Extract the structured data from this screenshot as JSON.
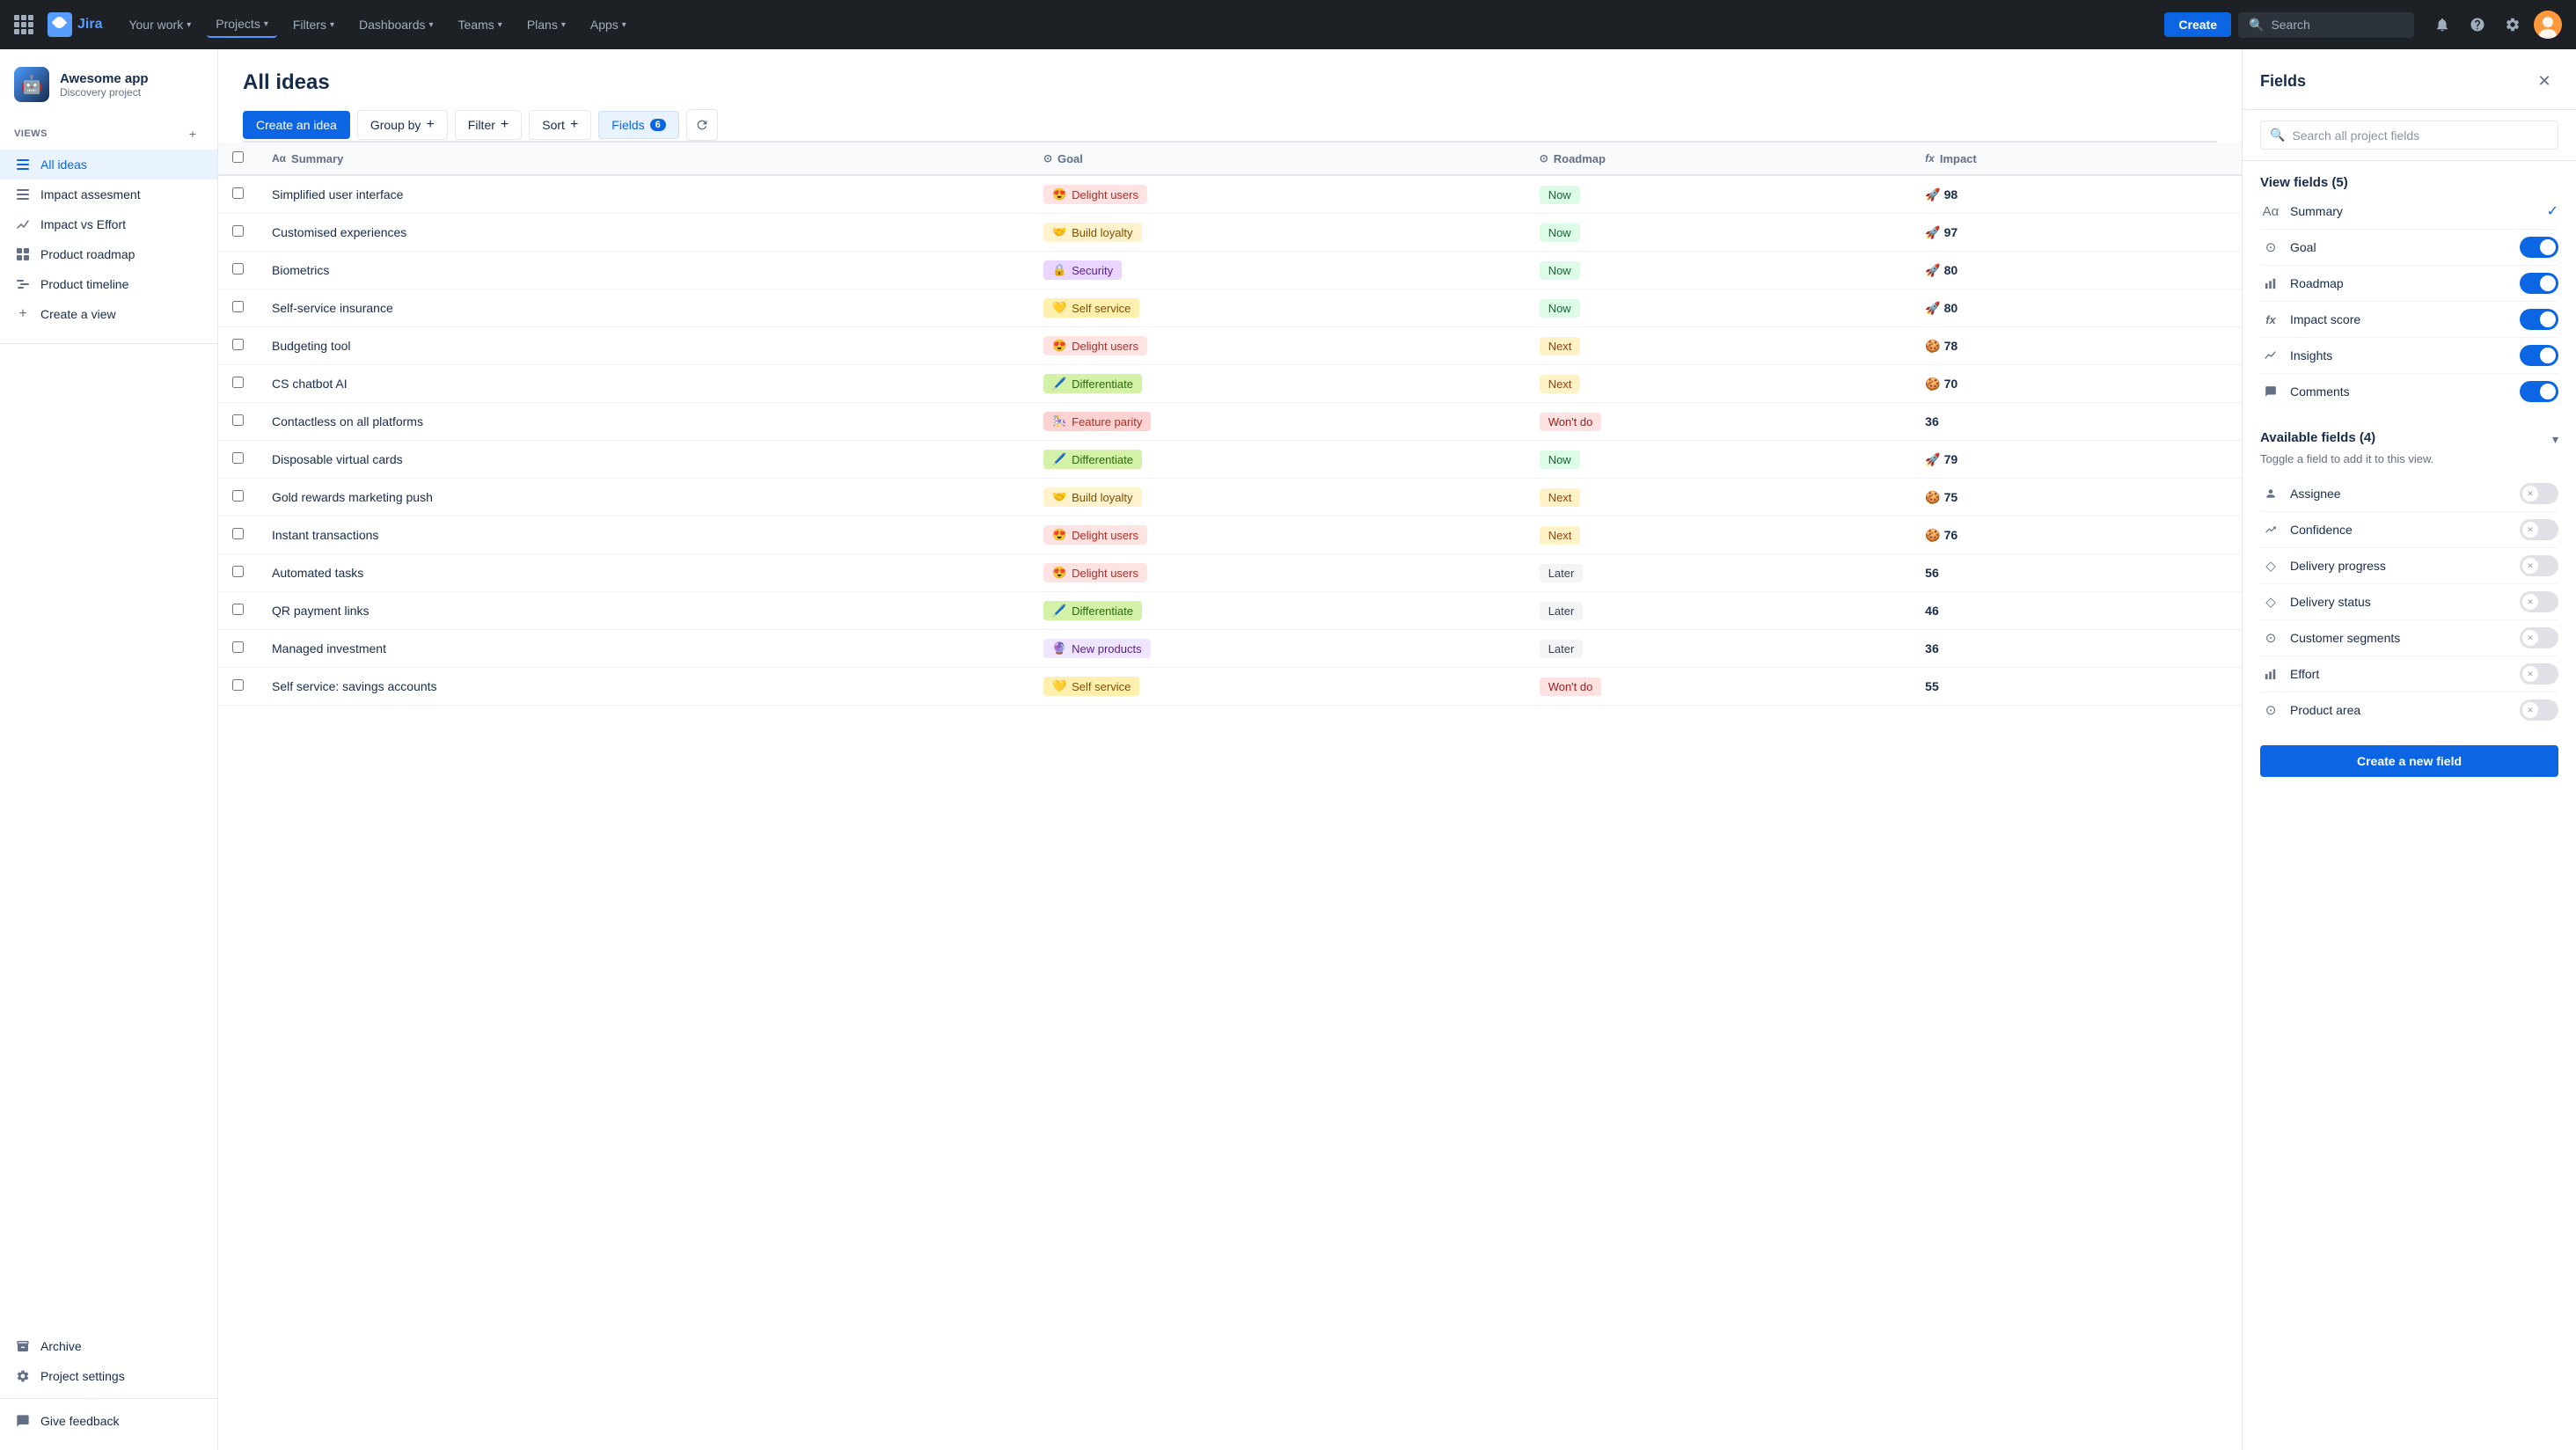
{
  "topnav": {
    "logo_text": "Jira",
    "nav_items": [
      {
        "label": "Your work",
        "id": "your-work"
      },
      {
        "label": "Projects",
        "id": "projects"
      },
      {
        "label": "Filters",
        "id": "filters"
      },
      {
        "label": "Dashboards",
        "id": "dashboards"
      },
      {
        "label": "Teams",
        "id": "teams"
      },
      {
        "label": "Plans",
        "id": "plans"
      },
      {
        "label": "Apps",
        "id": "apps"
      }
    ],
    "create_label": "Create",
    "search_placeholder": "Search"
  },
  "sidebar": {
    "project_name": "Awesome app",
    "project_type": "Discovery project",
    "views_label": "VIEWS",
    "items": [
      {
        "label": "All ideas",
        "id": "all-ideas",
        "active": true,
        "icon": "list"
      },
      {
        "label": "Impact assesment",
        "id": "impact-assesment",
        "icon": "list"
      },
      {
        "label": "Impact vs Effort",
        "id": "impact-vs-effort",
        "icon": "chart"
      },
      {
        "label": "Product roadmap",
        "id": "product-roadmap",
        "icon": "grid"
      },
      {
        "label": "Product timeline",
        "id": "product-timeline",
        "icon": "timeline"
      },
      {
        "label": "Create a view",
        "id": "create-view",
        "icon": "plus"
      }
    ],
    "archive_label": "Archive",
    "project_settings_label": "Project settings",
    "feedback_label": "Give feedback"
  },
  "toolbar": {
    "create_idea_label": "Create an idea",
    "group_by_label": "Group by",
    "filter_label": "Filter",
    "sort_label": "Sort",
    "fields_label": "Fields",
    "fields_count": "6"
  },
  "table": {
    "columns": [
      {
        "label": "Summary",
        "icon": "text"
      },
      {
        "label": "Goal",
        "icon": "circle"
      },
      {
        "label": "Roadmap",
        "icon": "circle"
      },
      {
        "label": "Impact",
        "icon": "fx"
      }
    ],
    "rows": [
      {
        "summary": "Simplified user interface",
        "goal": "Delight users",
        "goal_type": "delight",
        "goal_emoji": "😍",
        "roadmap": "Now",
        "roadmap_type": "now",
        "impact": 98,
        "impact_emoji": "🚀"
      },
      {
        "summary": "Customised experiences",
        "goal": "Build loyalty",
        "goal_type": "build",
        "goal_emoji": "🤝",
        "roadmap": "Now",
        "roadmap_type": "now",
        "impact": 97,
        "impact_emoji": "🚀"
      },
      {
        "summary": "Biometrics",
        "goal": "Security",
        "goal_type": "security",
        "goal_emoji": "🔒",
        "roadmap": "Now",
        "roadmap_type": "now",
        "impact": 80,
        "impact_emoji": "🚀"
      },
      {
        "summary": "Self-service insurance",
        "goal": "Self service",
        "goal_type": "selfservice",
        "goal_emoji": "💛",
        "roadmap": "Now",
        "roadmap_type": "now",
        "impact": 80,
        "impact_emoji": "🚀"
      },
      {
        "summary": "Budgeting tool",
        "goal": "Delight users",
        "goal_type": "delight",
        "goal_emoji": "😍",
        "roadmap": "Next",
        "roadmap_type": "next",
        "impact": 78,
        "impact_emoji": "🍪"
      },
      {
        "summary": "CS chatbot AI",
        "goal": "Differentiate",
        "goal_type": "differentiate",
        "goal_emoji": "🖊️",
        "roadmap": "Next",
        "roadmap_type": "next",
        "impact": 70,
        "impact_emoji": "🍪"
      },
      {
        "summary": "Contactless on all platforms",
        "goal": "Feature parity",
        "goal_type": "featureparity",
        "goal_emoji": "🎠",
        "roadmap": "Won't do",
        "roadmap_type": "wontdo",
        "impact": 36,
        "impact_emoji": ""
      },
      {
        "summary": "Disposable virtual cards",
        "goal": "Differentiate",
        "goal_type": "differentiate",
        "goal_emoji": "🖊️",
        "roadmap": "Now",
        "roadmap_type": "now",
        "impact": 79,
        "impact_emoji": "🚀"
      },
      {
        "summary": "Gold rewards marketing push",
        "goal": "Build loyalty",
        "goal_type": "build",
        "goal_emoji": "🤝",
        "roadmap": "Next",
        "roadmap_type": "next",
        "impact": 75,
        "impact_emoji": "🍪"
      },
      {
        "summary": "Instant transactions",
        "goal": "Delight users",
        "goal_type": "delight",
        "goal_emoji": "😍",
        "roadmap": "Next",
        "roadmap_type": "next",
        "impact": 76,
        "impact_emoji": "🍪"
      },
      {
        "summary": "Automated tasks",
        "goal": "Delight users",
        "goal_type": "delight",
        "goal_emoji": "😍",
        "roadmap": "Later",
        "roadmap_type": "later",
        "impact": 56,
        "impact_emoji": ""
      },
      {
        "summary": "QR payment links",
        "goal": "Differentiate",
        "goal_type": "differentiate",
        "goal_emoji": "🖊️",
        "roadmap": "Later",
        "roadmap_type": "later",
        "impact": 46,
        "impact_emoji": ""
      },
      {
        "summary": "Managed investment",
        "goal": "New products",
        "goal_type": "newproducts",
        "goal_emoji": "🔮",
        "roadmap": "Later",
        "roadmap_type": "later",
        "impact": 36,
        "impact_emoji": ""
      },
      {
        "summary": "Self service: savings accounts",
        "goal": "Self service",
        "goal_type": "selfservice",
        "goal_emoji": "💛",
        "roadmap": "Won't do",
        "roadmap_type": "wontdo",
        "impact": 55,
        "impact_emoji": ""
      }
    ]
  },
  "fields_panel": {
    "title": "Fields",
    "search_placeholder": "Search all project fields",
    "view_fields_label": "View fields (5)",
    "view_fields": [
      {
        "name": "Summary",
        "icon": "text",
        "enabled": true,
        "type": "check"
      },
      {
        "name": "Goal",
        "icon": "circle",
        "enabled": true,
        "type": "toggle"
      },
      {
        "name": "Roadmap",
        "icon": "bar",
        "enabled": true,
        "type": "toggle"
      },
      {
        "name": "Impact score",
        "icon": "fx",
        "enabled": true,
        "type": "toggle"
      },
      {
        "name": "Insights",
        "icon": "trend",
        "enabled": true,
        "type": "toggle"
      },
      {
        "name": "Comments",
        "icon": "comment",
        "enabled": true,
        "type": "toggle"
      }
    ],
    "available_fields_label": "Available fields (4)",
    "available_fields_desc": "Toggle a field to add it to this view.",
    "available_fields": [
      {
        "name": "Assignee",
        "icon": "person"
      },
      {
        "name": "Confidence",
        "icon": "arrows"
      },
      {
        "name": "Delivery progress",
        "icon": "diamond"
      },
      {
        "name": "Delivery status",
        "icon": "diamond"
      },
      {
        "name": "Customer segments",
        "icon": "circle"
      },
      {
        "name": "Effort",
        "icon": "bar"
      },
      {
        "name": "Product area",
        "icon": "circle"
      }
    ],
    "create_field_label": "Create a new field"
  }
}
